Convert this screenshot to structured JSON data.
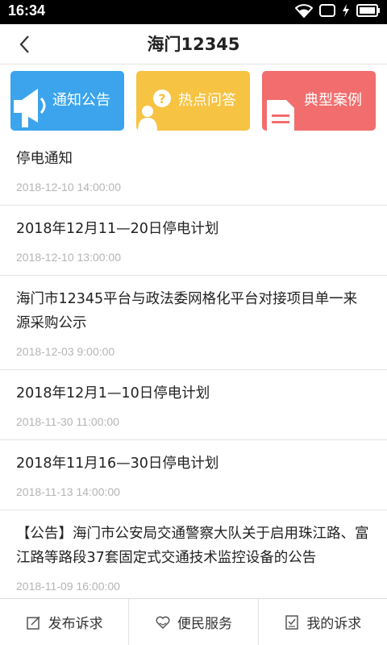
{
  "status_bar": {
    "time": "16:34",
    "icons": [
      "wifi-icon",
      "sim-icon",
      "charging-icon",
      "battery-icon"
    ]
  },
  "header": {
    "title": "海门12345",
    "back_icon": "chevron-left-icon"
  },
  "categories": [
    {
      "label": "通知公告",
      "icon": "megaphone-icon",
      "color": "#3ba4ec"
    },
    {
      "label": "热点问答",
      "icon": "question-person-icon",
      "color": "#f6c343"
    },
    {
      "label": "典型案例",
      "icon": "document-icon",
      "color": "#f26d6d"
    }
  ],
  "list": [
    {
      "title": "停电通知",
      "date": "2018-12-10 14:00:00"
    },
    {
      "title": "2018年12月11—20日停电计划",
      "date": "2018-12-10 13:00:00"
    },
    {
      "title": "海门市12345平台与政法委网格化平台对接项目单一来源采购公示",
      "date": "2018-12-03 9:00:00"
    },
    {
      "title": "2018年12月1—10日停电计划",
      "date": "2018-11-30 11:00:00"
    },
    {
      "title": "2018年11月16—30日停电计划",
      "date": "2018-11-13 14:00:00"
    },
    {
      "title": "【公告】海门市公安局交通警察大队关于启用珠江路、富江路等路段37套固定式交通技术监控设备的公告",
      "date": "2018-11-09 16:00:00"
    }
  ],
  "bottom_tabs": [
    {
      "label": "发布诉求",
      "icon": "edit-icon"
    },
    {
      "label": "便民服务",
      "icon": "heart-hand-icon"
    },
    {
      "label": "我的诉求",
      "icon": "checklist-icon"
    }
  ]
}
